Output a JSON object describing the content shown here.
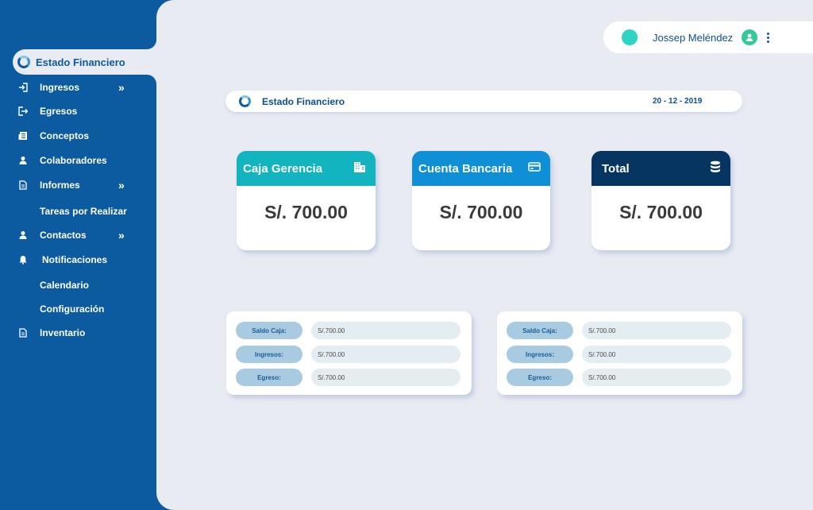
{
  "sidebar": {
    "active": "Estado Financiero",
    "items": [
      {
        "label": "Ingresos",
        "icon": "sign-in-icon",
        "chevron": "»"
      },
      {
        "label": "Egresos",
        "icon": "sign-out-icon",
        "chevron": ""
      },
      {
        "label": "Conceptos",
        "icon": "newspaper-icon",
        "chevron": ""
      },
      {
        "label": "Colaboradores",
        "icon": "user-icon",
        "chevron": ""
      },
      {
        "label": "Informes",
        "icon": "document-icon",
        "chevron": "»"
      },
      {
        "label": "Tareas por Realizar",
        "icon": "",
        "chevron": ""
      },
      {
        "label": "Contactos",
        "icon": "user-icon",
        "chevron": "»"
      },
      {
        "label": "Notificaciones",
        "icon": "bell-icon",
        "chevron": ""
      },
      {
        "label": "Calendario",
        "icon": "",
        "chevron": ""
      },
      {
        "label": "Configuración",
        "icon": "",
        "chevron": ""
      },
      {
        "label": "Inventario",
        "icon": "document-icon",
        "chevron": ""
      }
    ]
  },
  "user": {
    "name": "Jossep Meléndez",
    "status_color": "#2dd4c4"
  },
  "header": {
    "title": "Estado Financiero",
    "date": "20 - 12 - 2019"
  },
  "cards": [
    {
      "title": "Caja Gerencia",
      "amount": "S/. 700.00",
      "color": "#12b5bf",
      "icon": "building-icon"
    },
    {
      "title": "Cuenta Bancaria",
      "amount": "S/. 700.00",
      "color": "#0f8fd6",
      "icon": "credit-card-icon"
    },
    {
      "title": "Total",
      "amount": "S/. 700.00",
      "color": "#063562",
      "icon": "database-icon"
    }
  ],
  "panels": [
    {
      "rows": [
        {
          "label": "Saldo Caja:",
          "value": "S/.700.00"
        },
        {
          "label": "Ingresos:",
          "value": "S/.700.00"
        },
        {
          "label": "Egreso:",
          "value": "S/.700.00"
        }
      ]
    },
    {
      "rows": [
        {
          "label": "Saldo Caja:",
          "value": "S/.700.00"
        },
        {
          "label": "Ingresos:",
          "value": "S/.700.00"
        },
        {
          "label": "Egreso:",
          "value": "S/.700.00"
        }
      ]
    }
  ],
  "colors": {
    "sidebar": "#0c5aa0",
    "background": "#e9ebf3",
    "accent": "#0c4f8c"
  }
}
